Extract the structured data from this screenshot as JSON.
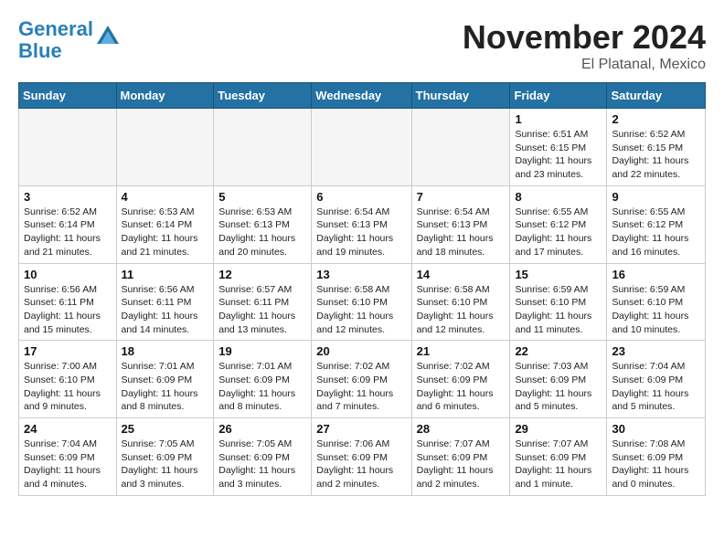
{
  "header": {
    "logo_line1": "General",
    "logo_line2": "Blue",
    "month": "November 2024",
    "location": "El Platanal, Mexico"
  },
  "weekdays": [
    "Sunday",
    "Monday",
    "Tuesday",
    "Wednesday",
    "Thursday",
    "Friday",
    "Saturday"
  ],
  "weeks": [
    [
      {
        "day": "",
        "info": ""
      },
      {
        "day": "",
        "info": ""
      },
      {
        "day": "",
        "info": ""
      },
      {
        "day": "",
        "info": ""
      },
      {
        "day": "",
        "info": ""
      },
      {
        "day": "1",
        "info": "Sunrise: 6:51 AM\nSunset: 6:15 PM\nDaylight: 11 hours and 23 minutes."
      },
      {
        "day": "2",
        "info": "Sunrise: 6:52 AM\nSunset: 6:15 PM\nDaylight: 11 hours and 22 minutes."
      }
    ],
    [
      {
        "day": "3",
        "info": "Sunrise: 6:52 AM\nSunset: 6:14 PM\nDaylight: 11 hours and 21 minutes."
      },
      {
        "day": "4",
        "info": "Sunrise: 6:53 AM\nSunset: 6:14 PM\nDaylight: 11 hours and 21 minutes."
      },
      {
        "day": "5",
        "info": "Sunrise: 6:53 AM\nSunset: 6:13 PM\nDaylight: 11 hours and 20 minutes."
      },
      {
        "day": "6",
        "info": "Sunrise: 6:54 AM\nSunset: 6:13 PM\nDaylight: 11 hours and 19 minutes."
      },
      {
        "day": "7",
        "info": "Sunrise: 6:54 AM\nSunset: 6:13 PM\nDaylight: 11 hours and 18 minutes."
      },
      {
        "day": "8",
        "info": "Sunrise: 6:55 AM\nSunset: 6:12 PM\nDaylight: 11 hours and 17 minutes."
      },
      {
        "day": "9",
        "info": "Sunrise: 6:55 AM\nSunset: 6:12 PM\nDaylight: 11 hours and 16 minutes."
      }
    ],
    [
      {
        "day": "10",
        "info": "Sunrise: 6:56 AM\nSunset: 6:11 PM\nDaylight: 11 hours and 15 minutes."
      },
      {
        "day": "11",
        "info": "Sunrise: 6:56 AM\nSunset: 6:11 PM\nDaylight: 11 hours and 14 minutes."
      },
      {
        "day": "12",
        "info": "Sunrise: 6:57 AM\nSunset: 6:11 PM\nDaylight: 11 hours and 13 minutes."
      },
      {
        "day": "13",
        "info": "Sunrise: 6:58 AM\nSunset: 6:10 PM\nDaylight: 11 hours and 12 minutes."
      },
      {
        "day": "14",
        "info": "Sunrise: 6:58 AM\nSunset: 6:10 PM\nDaylight: 11 hours and 12 minutes."
      },
      {
        "day": "15",
        "info": "Sunrise: 6:59 AM\nSunset: 6:10 PM\nDaylight: 11 hours and 11 minutes."
      },
      {
        "day": "16",
        "info": "Sunrise: 6:59 AM\nSunset: 6:10 PM\nDaylight: 11 hours and 10 minutes."
      }
    ],
    [
      {
        "day": "17",
        "info": "Sunrise: 7:00 AM\nSunset: 6:10 PM\nDaylight: 11 hours and 9 minutes."
      },
      {
        "day": "18",
        "info": "Sunrise: 7:01 AM\nSunset: 6:09 PM\nDaylight: 11 hours and 8 minutes."
      },
      {
        "day": "19",
        "info": "Sunrise: 7:01 AM\nSunset: 6:09 PM\nDaylight: 11 hours and 8 minutes."
      },
      {
        "day": "20",
        "info": "Sunrise: 7:02 AM\nSunset: 6:09 PM\nDaylight: 11 hours and 7 minutes."
      },
      {
        "day": "21",
        "info": "Sunrise: 7:02 AM\nSunset: 6:09 PM\nDaylight: 11 hours and 6 minutes."
      },
      {
        "day": "22",
        "info": "Sunrise: 7:03 AM\nSunset: 6:09 PM\nDaylight: 11 hours and 5 minutes."
      },
      {
        "day": "23",
        "info": "Sunrise: 7:04 AM\nSunset: 6:09 PM\nDaylight: 11 hours and 5 minutes."
      }
    ],
    [
      {
        "day": "24",
        "info": "Sunrise: 7:04 AM\nSunset: 6:09 PM\nDaylight: 11 hours and 4 minutes."
      },
      {
        "day": "25",
        "info": "Sunrise: 7:05 AM\nSunset: 6:09 PM\nDaylight: 11 hours and 3 minutes."
      },
      {
        "day": "26",
        "info": "Sunrise: 7:05 AM\nSunset: 6:09 PM\nDaylight: 11 hours and 3 minutes."
      },
      {
        "day": "27",
        "info": "Sunrise: 7:06 AM\nSunset: 6:09 PM\nDaylight: 11 hours and 2 minutes."
      },
      {
        "day": "28",
        "info": "Sunrise: 7:07 AM\nSunset: 6:09 PM\nDaylight: 11 hours and 2 minutes."
      },
      {
        "day": "29",
        "info": "Sunrise: 7:07 AM\nSunset: 6:09 PM\nDaylight: 11 hours and 1 minute."
      },
      {
        "day": "30",
        "info": "Sunrise: 7:08 AM\nSunset: 6:09 PM\nDaylight: 11 hours and 0 minutes."
      }
    ]
  ]
}
